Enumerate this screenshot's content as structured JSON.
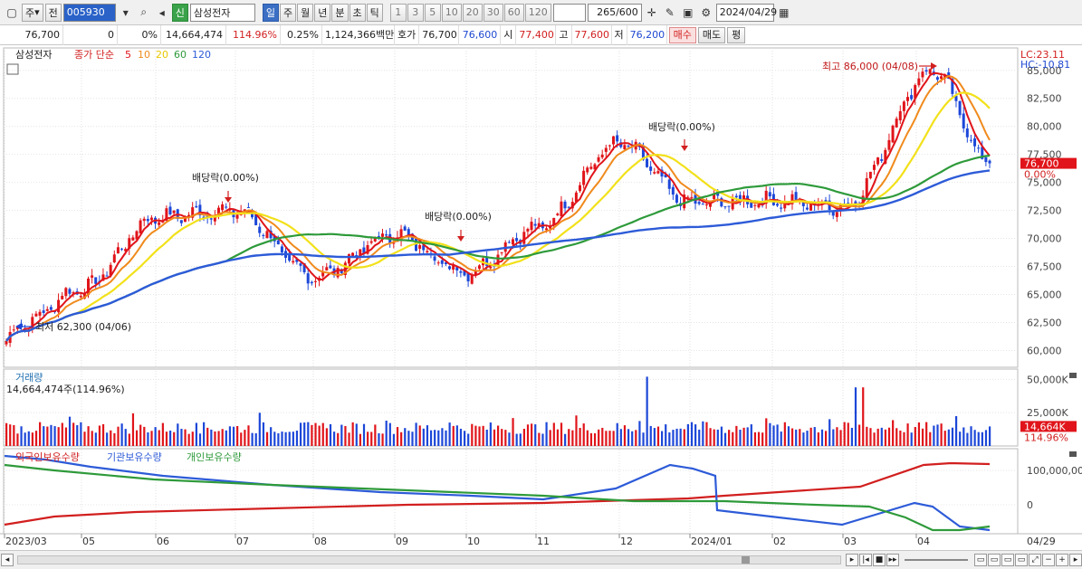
{
  "toolbar": {
    "type_label": "주",
    "prev_label": "전",
    "code": "005930",
    "name_badge": "신",
    "name": "삼성전자",
    "periods": [
      "일",
      "주",
      "월",
      "년",
      "분",
      "초",
      "틱"
    ],
    "active_period": "일",
    "intervals": [
      "1",
      "3",
      "5",
      "10",
      "20",
      "30",
      "60",
      "120"
    ],
    "count": "265",
    "count_total": "/600",
    "date": "2024/04/29"
  },
  "quote": {
    "price": "76,700",
    "change": "0",
    "change_pct": "0%",
    "volume": "14,664,474",
    "volume_ratio": "114.96%",
    "turnover_rate": "0.25%",
    "amount": "1,124,366백만",
    "ask_label": "호가",
    "ask": "76,700",
    "bid": "76,600",
    "open_label": "시",
    "open": "77,400",
    "high_label": "고",
    "high": "77,600",
    "low_label": "저",
    "low": "76,200",
    "buy_label": "매수",
    "sell_label": "매도",
    "avg_label": "평"
  },
  "chart_data": [
    {
      "type": "candlestick",
      "legend": {
        "name": "삼성전자",
        "ma_label": "종가 단순",
        "ma_periods": [
          "5",
          "10",
          "20",
          "60",
          "120"
        ]
      },
      "colors": {
        "up": "#e0141a",
        "down": "#1c47d8",
        "ma5": "#e0141a",
        "ma10": "#f08a1c",
        "ma20": "#f2e11a",
        "ma60": "#2e9a3a",
        "ma120": "#2d5bd8"
      },
      "x_ticks": [
        "2023/03",
        "05",
        "06",
        "07",
        "08",
        "09",
        "10",
        "11",
        "12",
        "2024/01",
        "02",
        "03",
        "04",
        "04/29"
      ],
      "y_ticks": [
        "85,000",
        "82,500",
        "80,000",
        "77,500",
        "75,000",
        "72,500",
        "70,000",
        "67,500",
        "65,000",
        "62,500",
        "60,000"
      ],
      "ylim": [
        58500,
        87000
      ],
      "corner_labels": {
        "lc": "LC:23.11",
        "hc": "HC:-10.81"
      },
      "annotations": [
        {
          "text": "최고 86,000 (04/08)",
          "value": 86000
        },
        {
          "text": "최저 62,300 (04/06)",
          "value": 62300
        },
        {
          "text": "배당락(0.00%)"
        },
        {
          "text": "배당락(0.00%)"
        },
        {
          "text": "배당락(0.00%)"
        }
      ],
      "current": {
        "price_label": "76,700",
        "pct_label": "0.00%",
        "value": 76700
      },
      "key_points": [
        {
          "date": "2023/03",
          "close": 60800
        },
        {
          "date": "2023/04/06",
          "close": 62300
        },
        {
          "date": "2023/05",
          "close": 65500
        },
        {
          "date": "2023/06",
          "close": 71900
        },
        {
          "date": "2023/07",
          "close": 72500
        },
        {
          "date": "2023/08",
          "close": 66600
        },
        {
          "date": "2023/09",
          "close": 70300
        },
        {
          "date": "2023/10",
          "close": 67000
        },
        {
          "date": "2023/11",
          "close": 70900
        },
        {
          "date": "2023/12",
          "close": 78500
        },
        {
          "date": "2024/01",
          "close": 73200
        },
        {
          "date": "2024/02",
          "close": 73400
        },
        {
          "date": "2024/03",
          "close": 72800
        },
        {
          "date": "2024/04/08",
          "close": 85000
        },
        {
          "date": "2024/04/29",
          "close": 76700
        }
      ]
    },
    {
      "type": "bar",
      "title": "거래량",
      "value_label": "14,664,474주(114.96%)",
      "y_ticks": [
        "50,000K",
        "25,000K"
      ],
      "ylim": [
        0,
        55000
      ],
      "current": {
        "label": "14,664K",
        "pct": "114.96%",
        "value": 14664
      }
    },
    {
      "type": "line",
      "legend": [
        "외국인보유수량",
        "기관보유수량",
        "개인보유수량"
      ],
      "colors": [
        "#d21f1f",
        "#2d5bd8",
        "#2e9a3a"
      ],
      "y_ticks": [
        "100,000,00",
        "0"
      ]
    }
  ]
}
